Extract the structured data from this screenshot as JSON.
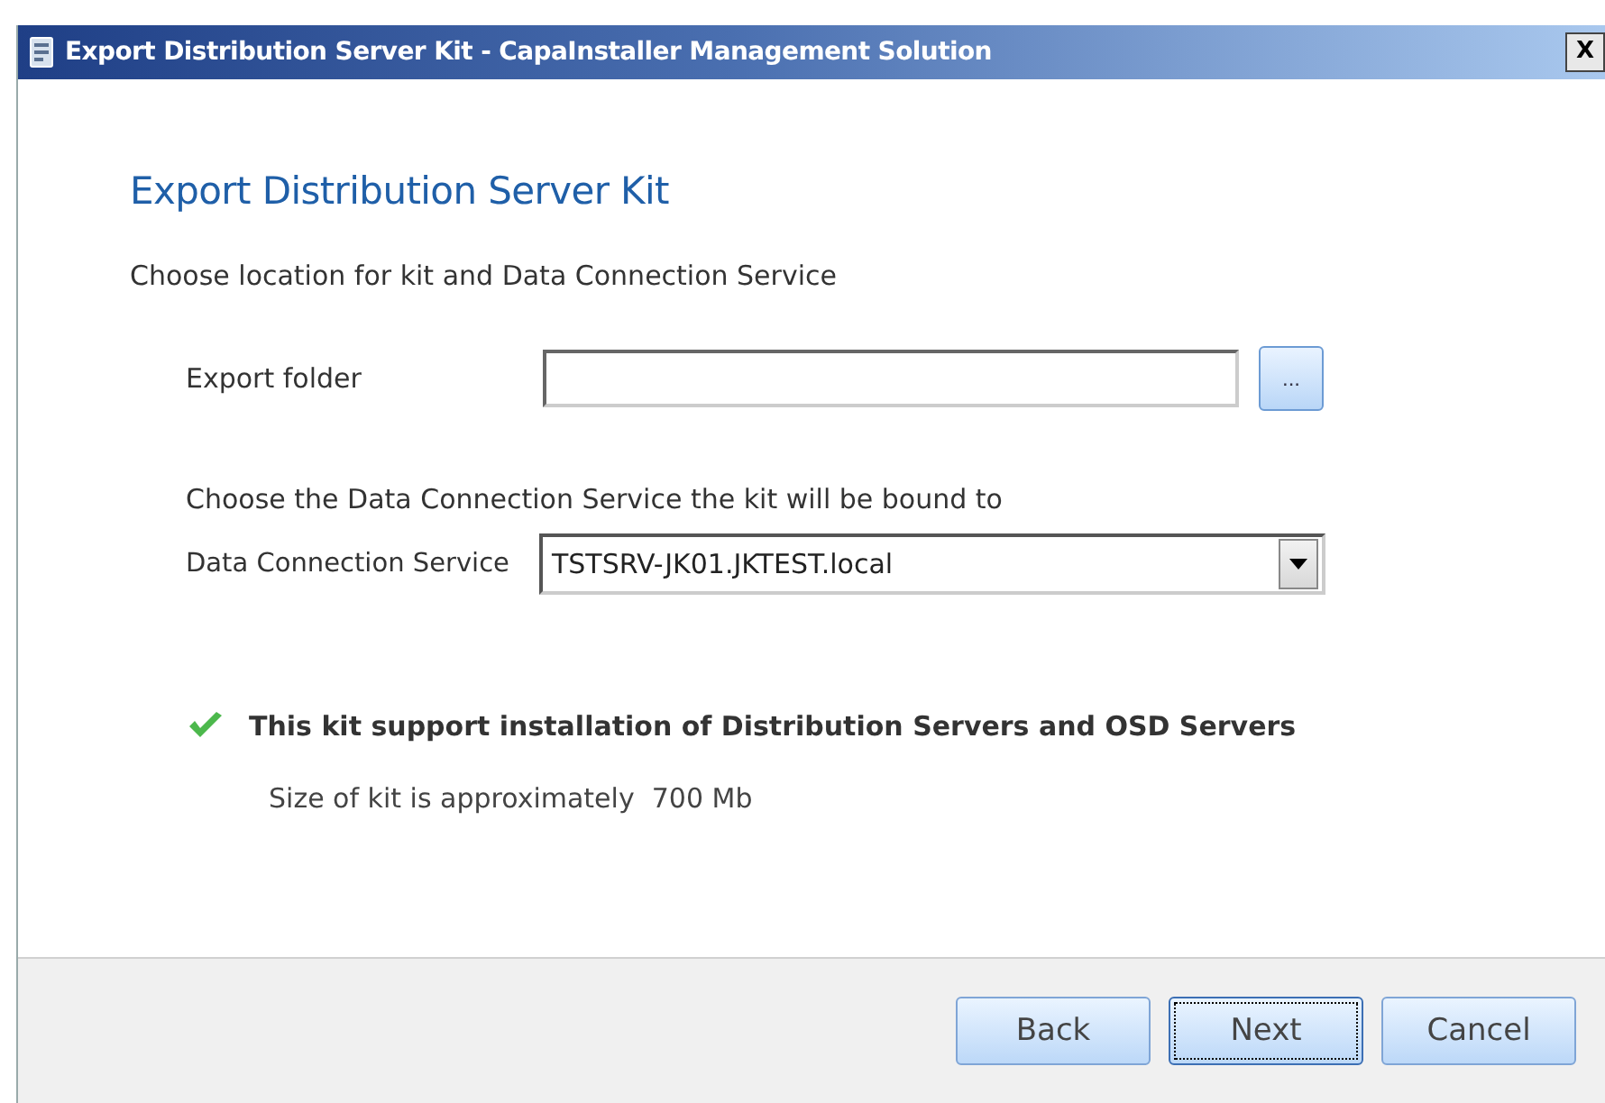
{
  "window": {
    "title": "Export Distribution Server Kit - CapaInstaller Management Solution",
    "close": "X"
  },
  "heading": "Export Distribution Server Kit",
  "subtitle": "Choose location for kit and Data Connection Service",
  "export_folder": {
    "label": "Export folder",
    "browse": "..."
  },
  "dcs_prompt": "Choose the Data Connection Service the kit will be bound to",
  "dcs": {
    "label": "Data Connection Service",
    "value": "TSTSRV-JK01.JKTEST.local"
  },
  "status": {
    "ok": true,
    "message": "This kit support installation of Distribution Servers and OSD Servers",
    "size": "Size of kit is approximately  700 Mb"
  },
  "buttons": [
    {
      "label": "Back",
      "focused": false
    },
    {
      "label": "Next",
      "focused": true
    },
    {
      "label": "Cancel",
      "focused": false
    }
  ]
}
